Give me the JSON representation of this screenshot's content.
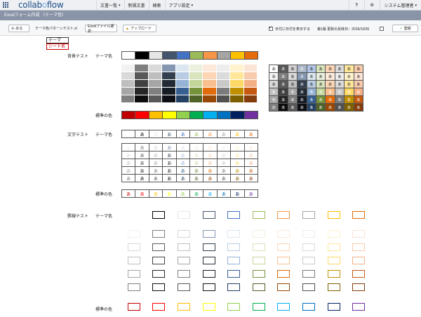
{
  "header": {
    "logo_main": "collab",
    "logo_o": "o",
    "logo_end": "flow",
    "nav": [
      "文書一覧",
      "新規文書",
      "検索",
      "アプリ設定"
    ],
    "nav_chevron": [
      true,
      false,
      false,
      true
    ],
    "help": "?",
    "user": "システム管理者"
  },
  "subbar": {
    "title": "Excelフォーム作成 （テーマ色）"
  },
  "toolbar": {
    "back_label": "戻る",
    "file_name": "テーマ色パターンテスト.xl",
    "select_label": "Excelファイル選択",
    "upload_label": "アップロード",
    "date_check_label": "日付に日付を表示する",
    "version_info": "第1版 更新の反映日：2016/10/26",
    "register_label": "登録"
  },
  "sheet_tabs": [
    "テーマ",
    "シート名"
  ],
  "labels": {
    "bg_test": "背景テスト",
    "text_test": "文字テスト",
    "border_test": "罫線テスト",
    "theme_color": "テーマ色",
    "standard_color": "標準の色",
    "glyph": "あ"
  },
  "colors": {
    "theme": [
      "#ffffff",
      "#000000",
      "#e7e6e6",
      "#44546a",
      "#4472c4",
      "#9bbb59",
      "#f79646",
      "#a5a5a5",
      "#ffc000",
      "#e46c0a"
    ],
    "theme_row_base": [
      "#ffffff",
      "#595959",
      "#d0cece",
      "#acb9ca",
      "#b4c6e7",
      "#d8e4bc",
      "#fcd5b4",
      "#dbdbdb",
      "#ffe699",
      "#f8cbad"
    ],
    "theme_shades": [
      [
        "#f2f2f2",
        "#7f7f7f",
        "#d9d9d9",
        "#8496b0",
        "#dce6f1",
        "#ebf1de",
        "#fde9d9",
        "#ededed",
        "#fff2cc",
        "#fbe4d5"
      ],
      [
        "#d9d9d9",
        "#595959",
        "#bfbfbf",
        "#333f4f",
        "#b8cce4",
        "#d8e4bc",
        "#fcd5b4",
        "#dbdbdb",
        "#ffe699",
        "#f8cbad"
      ],
      [
        "#bfbfbf",
        "#404040",
        "#a6a6a6",
        "#222b35",
        "#95b3d7",
        "#c4d79b",
        "#fabf8f",
        "#c9c9c9",
        "#ffd966",
        "#f4b084"
      ],
      [
        "#a6a6a6",
        "#262626",
        "#808080",
        "#161c24",
        "#366092",
        "#76933c",
        "#e26b0a",
        "#7b7b7b",
        "#bf8f00",
        "#c65911"
      ],
      [
        "#808080",
        "#0d0d0d",
        "#595959",
        "#0b0e12",
        "#244062",
        "#4f6228",
        "#974706",
        "#525252",
        "#7f6000",
        "#843c0c"
      ]
    ],
    "standard": [
      "#c00000",
      "#ff0000",
      "#ffc000",
      "#ffff00",
      "#92d050",
      "#00b050",
      "#00b0f0",
      "#0070c0",
      "#002060",
      "#7030a0"
    ],
    "text_theme": [
      "#ffffff",
      "#000000",
      "#e7e6e6",
      "#44546a",
      "#4472c4",
      "#9bbb59",
      "#f79646",
      "#a5a5a5",
      "#ffc000",
      "#e46c0a"
    ],
    "text_standard": [
      "#c00000",
      "#ff0000",
      "#ffc000",
      "#ffff00",
      "#92d050",
      "#00b050",
      "#00b0f0",
      "#0070c0",
      "#002060",
      "#7030a0"
    ],
    "border_theme": [
      "#ffffff",
      "#000000",
      "#e7e6e6",
      "#44546a",
      "#4472c4",
      "#9bbb59",
      "#f79646",
      "#a5a5a5",
      "#ffc000",
      "#e46c0a"
    ],
    "border_standard": [
      "#c00000",
      "#ff0000",
      "#ffc000",
      "#ffff00",
      "#92d050",
      "#00b050",
      "#00b0f0",
      "#0070c0",
      "#002060",
      "#7030a0"
    ]
  }
}
